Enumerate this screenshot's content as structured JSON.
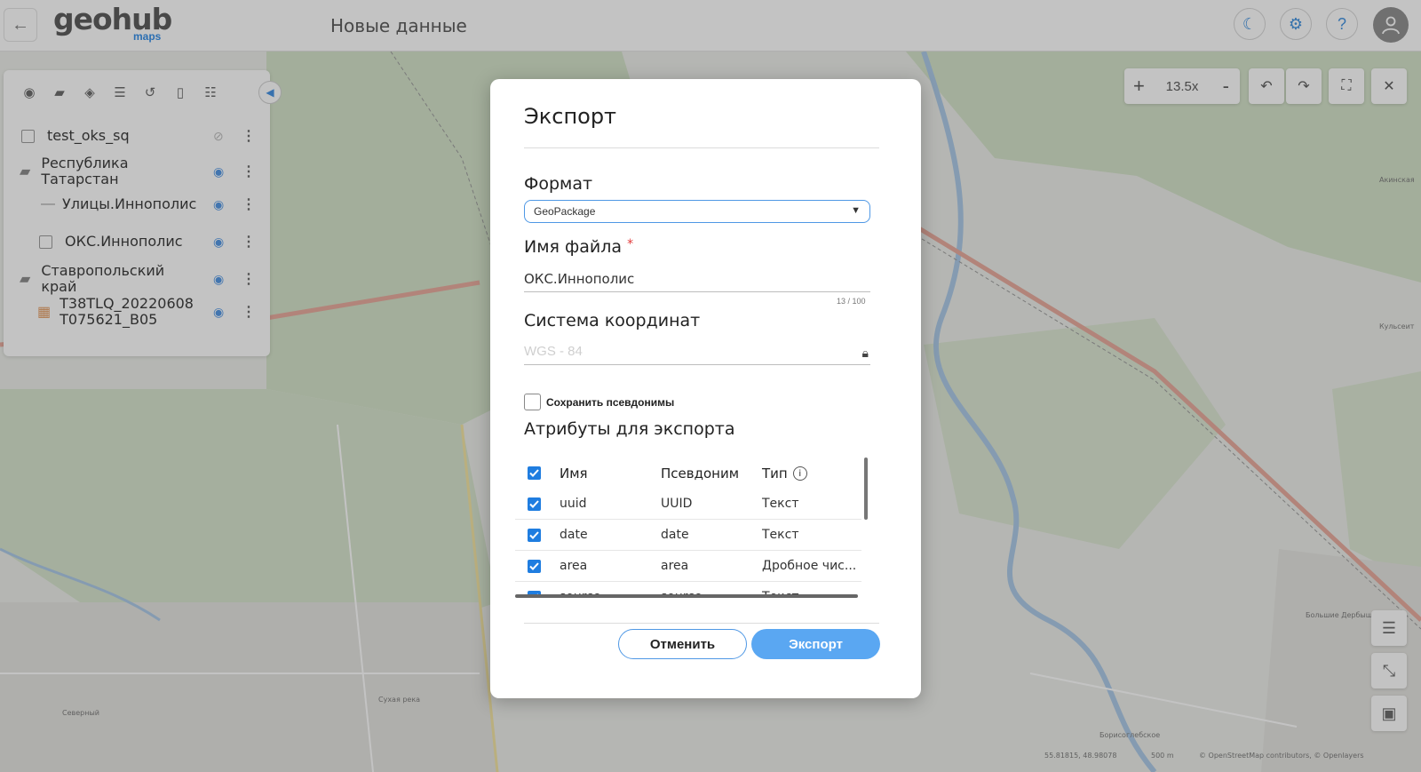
{
  "header": {
    "logo_main": "geohub",
    "logo_sub": "maps",
    "title": "Новые данные",
    "icons": [
      "back-arrow",
      "theme-moon",
      "settings-gear",
      "help-question",
      "user-avatar"
    ]
  },
  "layers": {
    "items": [
      {
        "name": "test_oks_sq",
        "type": "polygon"
      },
      {
        "name": "Республика Татарстан",
        "type": "folder"
      },
      {
        "name": "Улицы.Иннополис",
        "type": "line"
      },
      {
        "name": "ОКС.Иннополис",
        "type": "polygon"
      },
      {
        "name": "Ставропольский край",
        "type": "folder"
      },
      {
        "name": "T38TLQ_20220608 T075621_B05",
        "type": "raster"
      }
    ]
  },
  "map": {
    "zoom": "13.5x",
    "coords": "55.81815, 48.98078",
    "scale": "500 m",
    "attribution": "© OpenStreetMap contributors, © Openlayers",
    "places": [
      "Большие Дербышки",
      "Борисоглебское",
      "Сухая река",
      "Северный",
      "Кульсеит",
      "Акинская"
    ]
  },
  "modal": {
    "title": "Экспорт",
    "format_label": "Формат",
    "format_value": "GeoPackage",
    "filename_label": "Имя файла",
    "filename_required": "*",
    "filename_value": "ОКС.Иннополис",
    "filename_counter": "13 / 100",
    "crs_label": "Система координат",
    "crs_value": "WGS - 84",
    "keep_aliases_label": "Сохранить псевдонимы",
    "attributes_label": "Атрибуты для экспорта",
    "columns": {
      "name": "Имя",
      "alias": "Псевдоним",
      "type": "Тип"
    },
    "rows": [
      {
        "name": "uuid",
        "alias": "UUID",
        "type": "Текст",
        "checked": true
      },
      {
        "name": "date",
        "alias": "date",
        "type": "Текст",
        "checked": true
      },
      {
        "name": "area",
        "alias": "area",
        "type": "Дробное чис...",
        "checked": true
      },
      {
        "name": "source",
        "alias": "source",
        "type": "Текст",
        "checked": true
      }
    ],
    "cancel_label": "Отменить",
    "export_label": "Экспорт"
  },
  "colors": {
    "accent": "#1f7de0",
    "export_button": "#5aa7f2",
    "required": "#e23b3b"
  }
}
